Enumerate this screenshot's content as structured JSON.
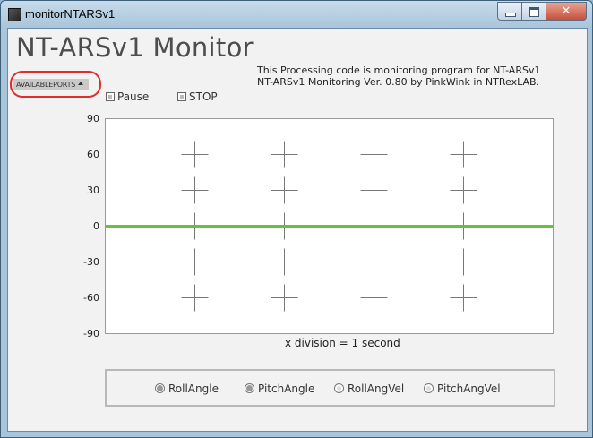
{
  "window": {
    "title": "monitorNTARSv1",
    "close_glyph": "✕"
  },
  "app": {
    "heading": "NT-ARSv1 Monitor",
    "info_line1": "This Processing code is monitoring program for NT-ARSv1",
    "info_line2": "NT-ARSv1  Monitoring Ver. 0.80 by PinkWink in NTRexLAB."
  },
  "controls": {
    "ports_label": "AVAILABLEPORTS",
    "pause_label": "Pause",
    "stop_label": "STOP"
  },
  "plot": {
    "y_ticks": [
      "90",
      "60",
      "30",
      "0",
      "-30",
      "-60",
      "-90"
    ],
    "x_division_label": "x division = 1 second",
    "line_color": "#66c23a"
  },
  "chart_data": {
    "type": "line",
    "ylim": [
      -90,
      90
    ],
    "y_ticks": [
      90,
      60,
      30,
      0,
      -30,
      -60,
      -90
    ],
    "series": [
      {
        "name": "RollAngle",
        "values": [
          0,
          0
        ]
      },
      {
        "name": "PitchAngle",
        "values": [
          0,
          0
        ]
      }
    ],
    "grid_x_divisions": 5
  },
  "legend": {
    "items": [
      {
        "label": "RollAngle",
        "selected": true
      },
      {
        "label": "PitchAngle",
        "selected": true
      },
      {
        "label": "RollAngVel",
        "selected": false
      },
      {
        "label": "PitchAngVel",
        "selected": false
      }
    ]
  }
}
